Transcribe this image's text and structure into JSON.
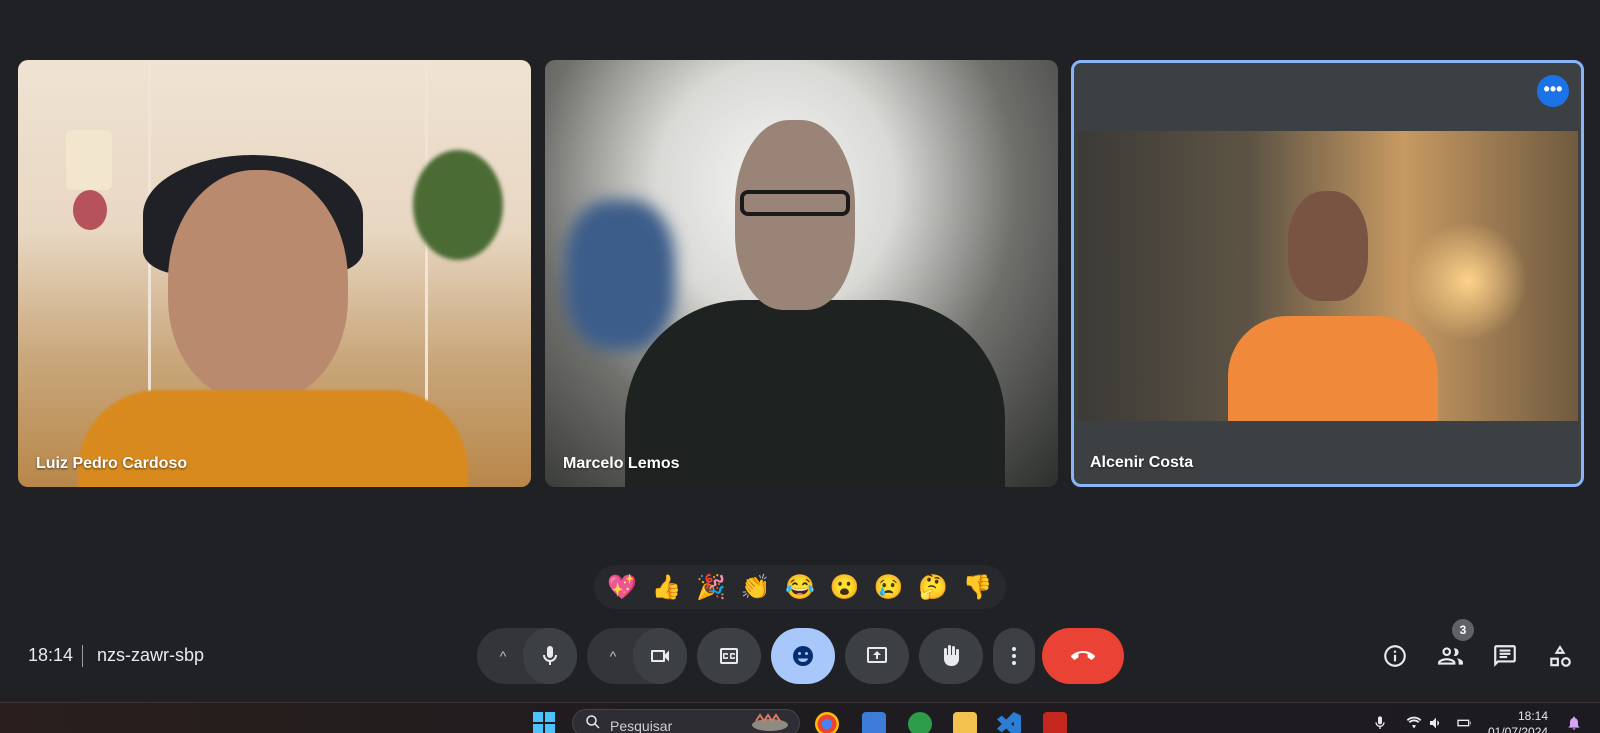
{
  "participants": [
    {
      "name": "Luiz Pedro Cardoso"
    },
    {
      "name": "Marcelo Lemos"
    },
    {
      "name": "Alcenir Costa"
    }
  ],
  "tile_menu": {
    "label": "•••",
    "icon": "more-options-icon"
  },
  "reactions": [
    "💖",
    "👍",
    "🎉",
    "👏",
    "😂",
    "😮",
    "😢",
    "🤔",
    "👎"
  ],
  "meeting": {
    "time": "18:14",
    "code": "nzs-zawr-sbp"
  },
  "controls": {
    "mic_options": {
      "icon": "chevron-up-icon",
      "glyph": "^"
    },
    "mic": {
      "icon": "mic-icon"
    },
    "camera_options": {
      "icon": "chevron-up-icon",
      "glyph": "^"
    },
    "camera": {
      "icon": "videocam-icon"
    },
    "captions": {
      "icon": "closed-captions-icon"
    },
    "emoji": {
      "icon": "emoji-icon",
      "active": true
    },
    "present": {
      "icon": "present-screen-icon"
    },
    "raise_hand": {
      "icon": "hand-icon"
    },
    "more": {
      "icon": "more-vert-icon"
    },
    "leave": {
      "icon": "call-end-icon",
      "color": "#ea4335"
    }
  },
  "side_controls": {
    "info": {
      "icon": "info-icon"
    },
    "people": {
      "icon": "people-icon",
      "badge": "3"
    },
    "chat": {
      "icon": "chat-icon"
    },
    "activities": {
      "icon": "activities-icon"
    }
  },
  "taskbar": {
    "search_placeholder": "Pesquisar",
    "clock_time": "18:14",
    "clock_date": "01/07/2024"
  },
  "colors": {
    "background": "#202124",
    "active_tile_border": "#8ab4f8",
    "active_control": "#a8c7fa",
    "end_call": "#ea4335",
    "more_button": "#1a73e8"
  }
}
